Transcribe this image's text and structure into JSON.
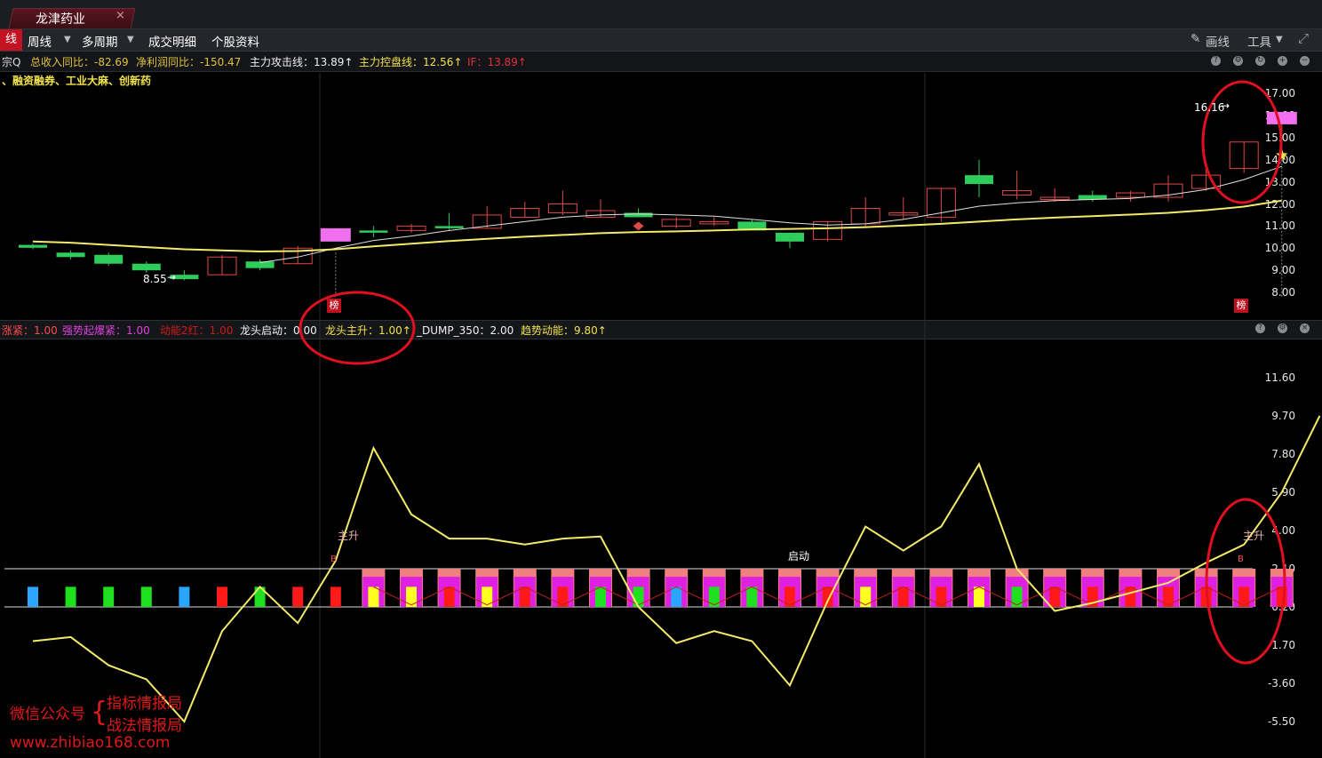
{
  "tab": {
    "title": "龙津药业",
    "close": "×"
  },
  "toolbar": {
    "left_badge": "线",
    "items": [
      "周线",
      "多周期",
      "成交明细",
      "个股资料"
    ],
    "draw_label": "画线",
    "tools_label": "工具",
    "expand_icon": "expand-icon"
  },
  "info": [
    {
      "text": "宗Q",
      "color": "#cfcfcf"
    },
    {
      "text": "总收入同比：-82.69",
      "color": "#e0c23a"
    },
    {
      "text": "净利润同比：-150.47",
      "color": "#e0c23a"
    },
    {
      "text": "主力攻击线：13.89↑",
      "color": "#f0f0f0"
    },
    {
      "text": "主力控盘线：12.56↑",
      "color": "#f2e24a"
    },
    {
      "text": "IF：13.89↑",
      "color": "#e0303a"
    }
  ],
  "concepts": "、融资融券、工业大麻、创新药",
  "price_axis": [
    "17.00",
    "16.00",
    "15.00",
    "14.00",
    "13.00",
    "12.00",
    "11.00",
    "10.00",
    "9.00",
    "8.00"
  ],
  "price_labels": {
    "high": "16.16",
    "low": "8.55",
    "bang": "榜"
  },
  "indicator_bar": [
    {
      "text": "涨紧：1.00",
      "color": "#ff4a4a"
    },
    {
      "text": "强势起爆紧：1.00",
      "color": "#e040e0"
    },
    {
      "text": "动能2红：1.00",
      "color": "#d01818"
    },
    {
      "text": "龙头启动：0.00",
      "color": "#f0f0f0"
    },
    {
      "text": "龙头主升：1.00↑",
      "color": "#f2e24a"
    },
    {
      "text": "_DUMP_350：2.00",
      "color": "#f0f0f0"
    },
    {
      "text": "趋势动能：9.80↑",
      "color": "#f2e24a"
    }
  ],
  "ind_axis": [
    "11.60",
    "9.70",
    "7.80",
    "5.90",
    "4.00",
    "2.10",
    "0.20",
    "-1.70",
    "-3.60",
    "-5.50"
  ],
  "ind_labels": {
    "main_rise": "主升",
    "start": "启动",
    "b": "B"
  },
  "watermark": {
    "wechat": "微信公众号",
    "brace": "{",
    "line1": "指标情报局",
    "line2": "战法情报局",
    "url": "www.zhibiao168.com"
  },
  "colors": {
    "up": "#e04848",
    "down": "#2ecc5a",
    "ma_yellow": "#f4ea6a",
    "annotation": "#e01020"
  },
  "chart_data": {
    "type": "candlestick",
    "candles": [
      {
        "o": 10.15,
        "c": 10.02,
        "h": 10.2,
        "l": 9.95
      },
      {
        "o": 9.8,
        "c": 9.6,
        "h": 9.9,
        "l": 9.5
      },
      {
        "o": 9.7,
        "c": 9.3,
        "h": 9.8,
        "l": 9.2
      },
      {
        "o": 9.3,
        "c": 9.0,
        "h": 9.4,
        "l": 8.9
      },
      {
        "o": 8.8,
        "c": 8.6,
        "h": 9.0,
        "l": 8.55
      },
      {
        "o": 8.8,
        "c": 9.6,
        "h": 9.7,
        "l": 8.8
      },
      {
        "o": 9.4,
        "c": 9.1,
        "h": 9.5,
        "l": 9.0
      },
      {
        "o": 9.3,
        "c": 10.0,
        "h": 10.1,
        "l": 9.3
      },
      {
        "o": 10.3,
        "c": 10.9,
        "h": 10.9,
        "l": 10.3
      },
      {
        "o": 10.8,
        "c": 10.7,
        "h": 11.0,
        "l": 10.5
      },
      {
        "o": 10.8,
        "c": 11.0,
        "h": 11.1,
        "l": 10.7
      },
      {
        "o": 11.0,
        "c": 10.9,
        "h": 11.6,
        "l": 10.8
      },
      {
        "o": 10.9,
        "c": 11.5,
        "h": 11.9,
        "l": 10.9
      },
      {
        "o": 11.4,
        "c": 11.8,
        "h": 12.1,
        "l": 11.4
      },
      {
        "o": 11.6,
        "c": 12.0,
        "h": 12.6,
        "l": 11.5
      },
      {
        "o": 11.4,
        "c": 11.7,
        "h": 12.2,
        "l": 11.4
      },
      {
        "o": 11.6,
        "c": 11.4,
        "h": 11.8,
        "l": 11.4
      },
      {
        "o": 11.0,
        "c": 11.3,
        "h": 11.4,
        "l": 10.9
      },
      {
        "o": 11.1,
        "c": 11.2,
        "h": 11.4,
        "l": 11.0
      },
      {
        "o": 11.2,
        "c": 10.8,
        "h": 11.3,
        "l": 10.8
      },
      {
        "o": 10.7,
        "c": 10.3,
        "h": 10.7,
        "l": 10.0
      },
      {
        "o": 10.4,
        "c": 11.2,
        "h": 11.2,
        "l": 10.3
      },
      {
        "o": 11.1,
        "c": 11.8,
        "h": 12.3,
        "l": 10.9
      },
      {
        "o": 11.5,
        "c": 11.6,
        "h": 12.3,
        "l": 11.3
      },
      {
        "o": 11.4,
        "c": 12.7,
        "h": 12.7,
        "l": 11.2
      },
      {
        "o": 13.3,
        "c": 12.9,
        "h": 14.0,
        "l": 12.3
      },
      {
        "o": 12.4,
        "c": 12.6,
        "h": 13.5,
        "l": 12.2
      },
      {
        "o": 12.2,
        "c": 12.3,
        "h": 12.7,
        "l": 12.1
      },
      {
        "o": 12.4,
        "c": 12.2,
        "h": 12.6,
        "l": 12.1
      },
      {
        "o": 12.3,
        "c": 12.5,
        "h": 12.6,
        "l": 12.1
      },
      {
        "o": 12.3,
        "c": 12.9,
        "h": 13.3,
        "l": 12.1
      },
      {
        "o": 12.7,
        "c": 13.3,
        "h": 13.9,
        "l": 12.6
      },
      {
        "o": 13.6,
        "c": 14.8,
        "h": 14.8,
        "l": 13.4
      },
      {
        "o": 15.6,
        "c": 16.16,
        "h": 16.16,
        "l": 14.0
      }
    ],
    "ma_yellow": [
      10.3,
      10.25,
      10.15,
      10.05,
      9.95,
      9.9,
      9.85,
      9.87,
      9.95,
      10.08,
      10.2,
      10.32,
      10.42,
      10.52,
      10.6,
      10.68,
      10.73,
      10.76,
      10.8,
      10.85,
      10.87,
      10.9,
      10.95,
      11.02,
      11.1,
      11.2,
      11.3,
      11.38,
      11.45,
      11.52,
      11.6,
      11.72,
      11.88,
      12.15
    ],
    "ma_white": [
      null,
      null,
      null,
      null,
      null,
      null,
      9.35,
      9.6,
      10.0,
      10.35,
      10.55,
      10.8,
      11.0,
      11.2,
      11.4,
      11.5,
      11.55,
      11.5,
      11.45,
      11.3,
      11.15,
      11.05,
      11.1,
      11.3,
      11.6,
      11.9,
      12.05,
      12.15,
      12.2,
      12.25,
      12.4,
      12.65,
      13.1,
      13.7
    ],
    "indicator_line": [
      -1.5,
      -1.3,
      -2.7,
      -3.4,
      -5.5,
      -1.0,
      1.2,
      -0.6,
      2.5,
      8.1,
      4.8,
      3.6,
      3.6,
      3.3,
      3.6,
      3.7,
      0.2,
      -1.6,
      -1.0,
      -1.5,
      -3.7,
      0.5,
      4.2,
      3.0,
      4.2,
      7.3,
      2.1,
      0.0,
      0.4,
      0.9,
      1.4,
      2.4,
      3.3,
      5.9,
      9.7
    ],
    "ind_bars": [
      "blue",
      "green",
      "green",
      "green",
      "blue",
      "red",
      "green",
      "red",
      "red",
      "yellow",
      "yellow",
      "red",
      "yellow",
      "red",
      "red",
      "green",
      "green",
      "blue",
      "green",
      "green",
      "red",
      "red",
      "yellow",
      "red",
      "red",
      "yellow",
      "green",
      "red",
      "red",
      "red",
      "red",
      "red",
      "red",
      "red"
    ]
  }
}
